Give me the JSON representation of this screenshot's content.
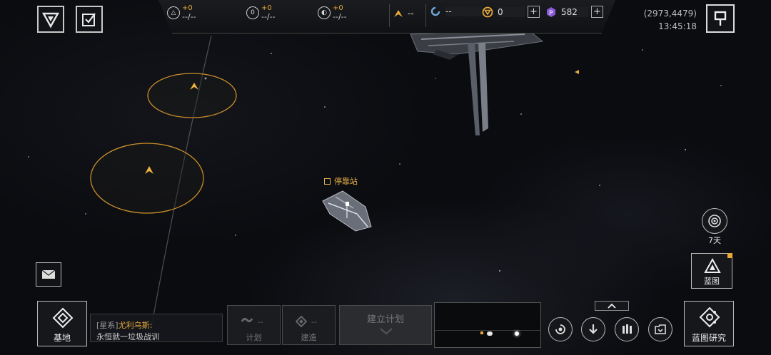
{
  "resources": [
    {
      "name": "triangle-resource",
      "delta": "+0",
      "value": "--/--"
    },
    {
      "name": "zero-resource",
      "delta": "+0",
      "value": "--/--"
    },
    {
      "name": "disc-resource",
      "delta": "+0",
      "value": "--/--"
    }
  ],
  "fleet_value": "--",
  "currencies": [
    {
      "name": "cycle-currency",
      "value": "--"
    },
    {
      "name": "gold-currency",
      "value": "0"
    },
    {
      "name": "purple-currency",
      "value": "582"
    }
  ],
  "coords": "(2973,4479)",
  "clock": "13:45:18",
  "map": {
    "dock_label": "停靠站"
  },
  "cycle": {
    "label": "7天"
  },
  "blueprint": {
    "label": "蓝图"
  },
  "chat": {
    "channel": "[星系]",
    "sender": "尤利乌斯:",
    "message": "永恒就一垃圾战训"
  },
  "bottom": {
    "base_label": "基地",
    "plan_label": "计划",
    "plan_value": "--",
    "build_label": "建造",
    "build_value": "--",
    "establish_plan": "建立计划",
    "research_label": "蓝图研究"
  },
  "colors": {
    "accent": "#e8a93a",
    "outline": "#c9c9c9"
  }
}
